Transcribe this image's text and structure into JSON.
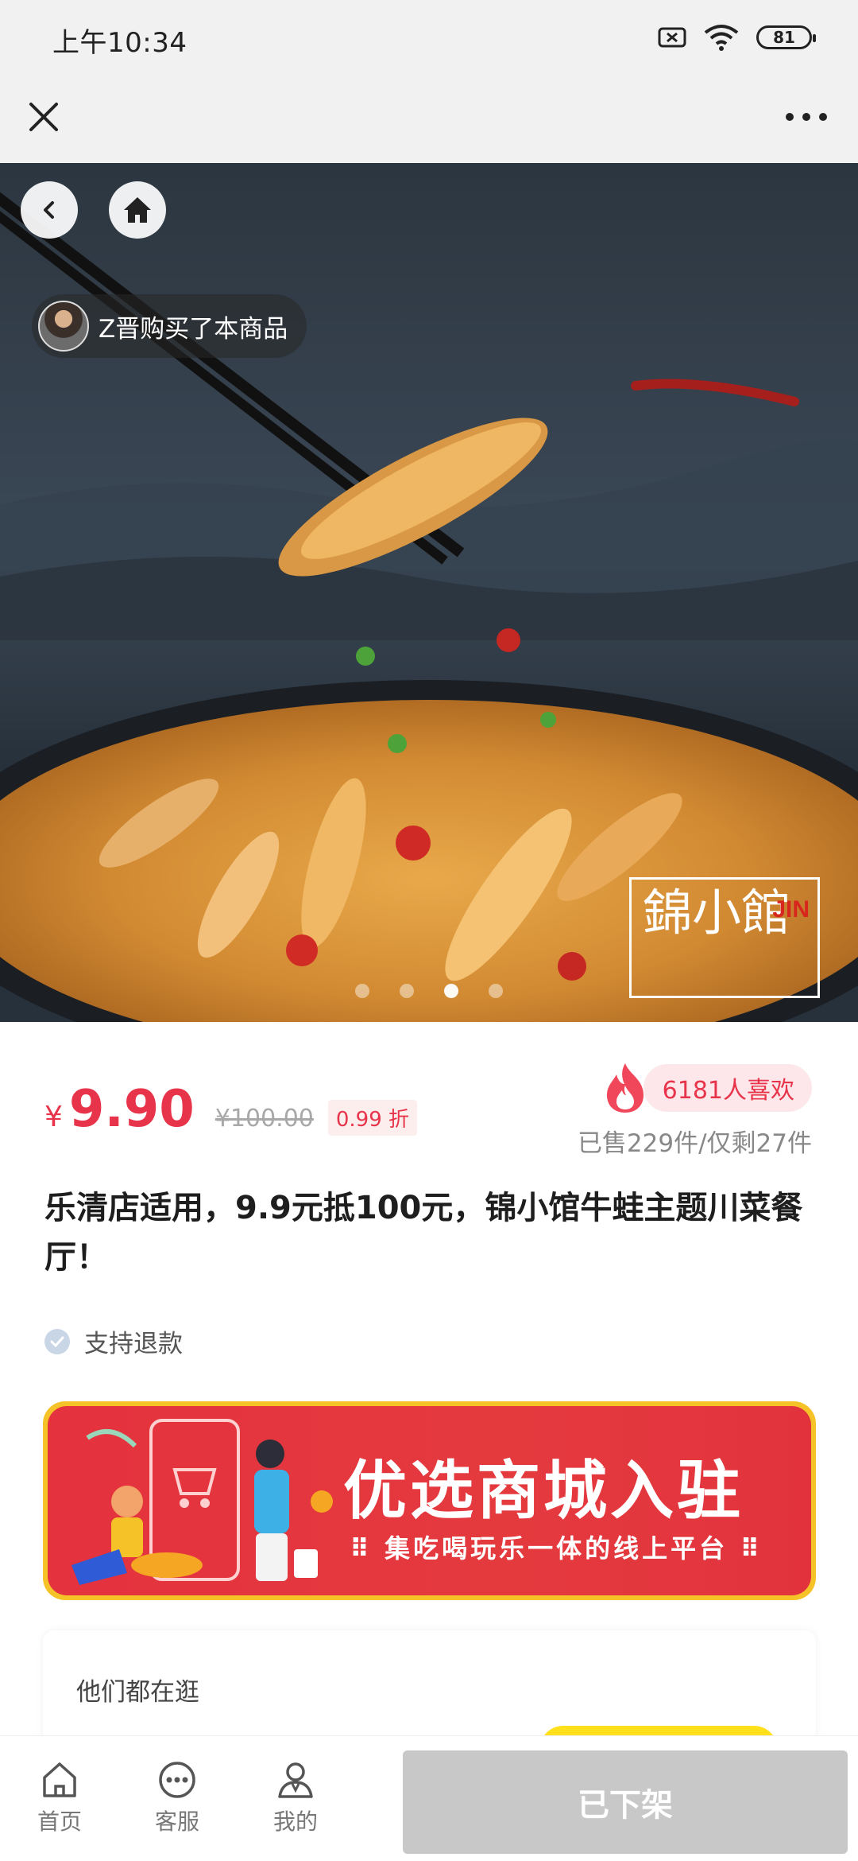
{
  "status_bar": {
    "time": "上午10:34",
    "battery": "81",
    "icons": [
      "sim-x-icon",
      "wifi-icon",
      "battery-icon"
    ]
  },
  "nav": {
    "close_icon": "close-icon",
    "more_icon": "more-icon"
  },
  "hero": {
    "buyer_text": "Z晋购买了本商品",
    "carousel_count": 4,
    "carousel_active": 3,
    "logo_text": "錦小館",
    "logo_mark": "JIN"
  },
  "product": {
    "currency": "¥",
    "price": "9.90",
    "original_price": "¥100.00",
    "discount": "0.99 折",
    "likes": "6181人喜欢",
    "sales": "已售229件/仅剩27件",
    "title": "乐清店适用，9.9元抵100元，锦小馆牛蛙主题川菜餐厅！",
    "refund": "支持退款"
  },
  "banner": {
    "title": "优选商城入驻",
    "subtitle": "⠿ 集吃喝玩乐一体的线上平台 ⠿"
  },
  "recommend": {
    "title": "他们都在逛"
  },
  "bottom_bar": {
    "tabs": [
      {
        "label": "首页",
        "icon": "home-icon"
      },
      {
        "label": "客服",
        "icon": "chat-icon"
      },
      {
        "label": "我的",
        "icon": "user-icon"
      }
    ],
    "action_label": "已下架"
  },
  "colors": {
    "price_red": "#e8344a",
    "banner_red": "#e4323e",
    "banner_border": "#f5c328",
    "disabled_gray": "#c8c8c8"
  }
}
